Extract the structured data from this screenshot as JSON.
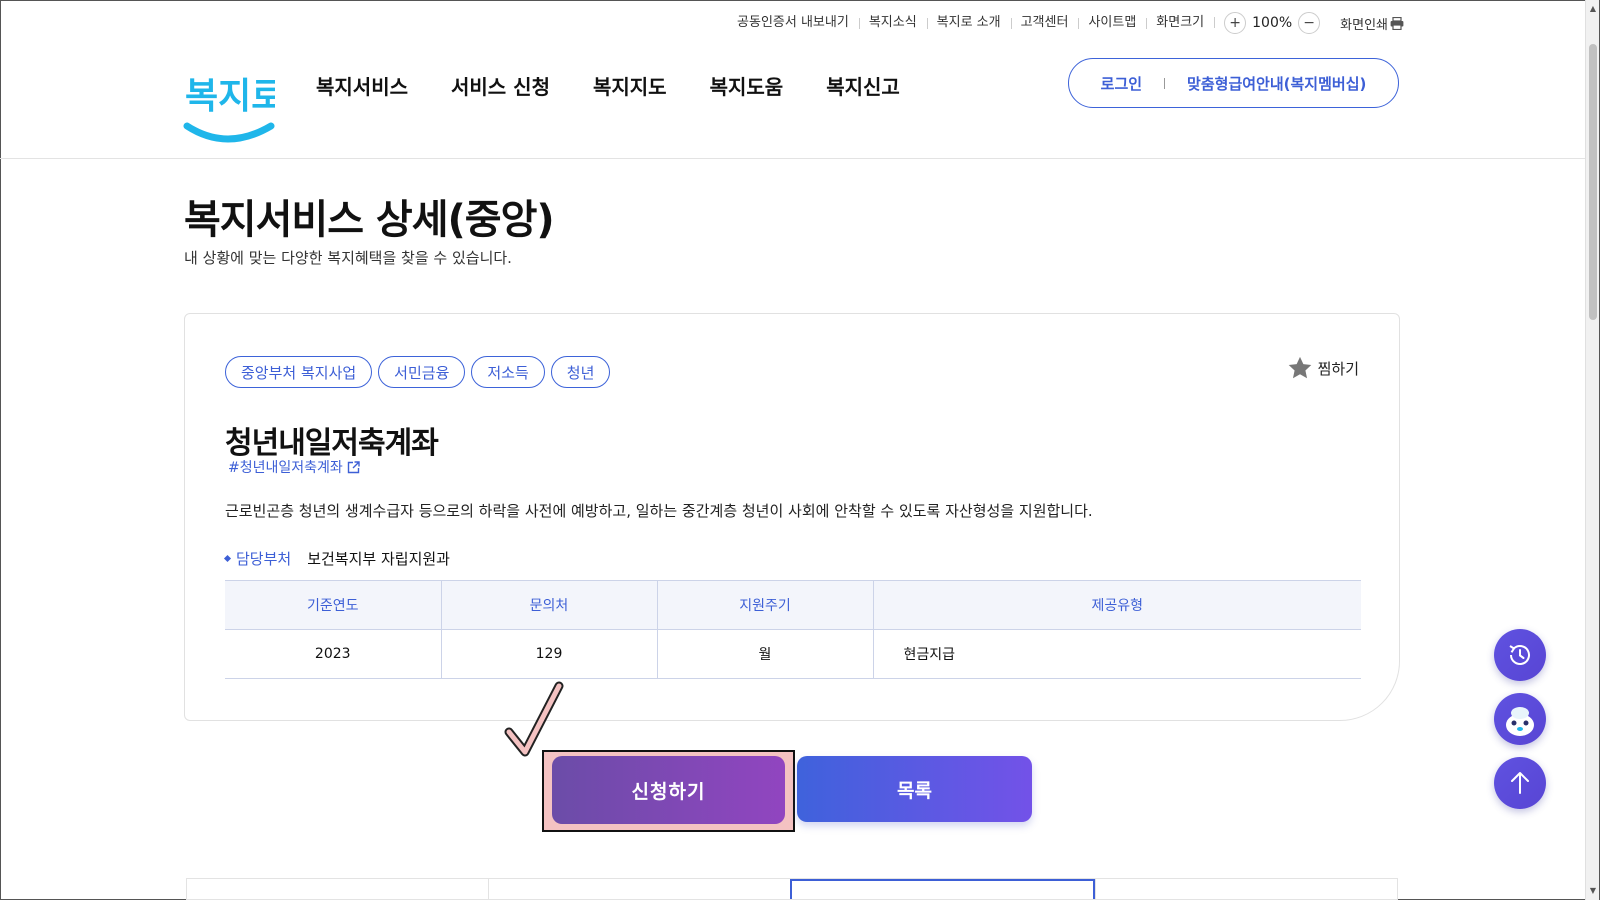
{
  "util": {
    "cert": "공동인증서 내보내기",
    "news": "복지소식",
    "about": "복지로 소개",
    "cs": "고객센터",
    "sitemap": "사이트맵",
    "screen_size": "화면크기",
    "zoom_in": "+",
    "zoom": "100%",
    "zoom_out": "−",
    "print": "화면인쇄"
  },
  "header": {
    "logo_text": "복지로",
    "nav": [
      "복지서비스",
      "서비스 신청",
      "복지지도",
      "복지도움",
      "복지신고"
    ],
    "login": "로그인",
    "membership": "맞춤형급여안내(복지멤버십)"
  },
  "page": {
    "title": "복지서비스 상세(중앙)",
    "subtitle": "내 상황에 맞는 다양한 복지혜택을 찾을 수 있습니다."
  },
  "service": {
    "tags": [
      "중앙부처 복지사업",
      "서민금융",
      "저소득",
      "청년"
    ],
    "favorite": "찜하기",
    "name": "청년내일저축계좌",
    "hashtag": "#청년내일저축계좌",
    "description": "근로빈곤층 청년의 생계수급자 등으로의 하락을 사전에 예방하고, 일하는 중간계층 청년이 사회에 안착할 수 있도록 자산형성을 지원합니다.",
    "dept_label": "담당부처",
    "dept_value": "보건복지부 자립지원과",
    "table": {
      "headers": [
        "기준연도",
        "문의처",
        "지원주기",
        "제공유형"
      ],
      "row": [
        "2023",
        "129",
        "월",
        "현금지급"
      ]
    }
  },
  "actions": {
    "apply": "신청하기",
    "list": "목록"
  },
  "colors": {
    "accent": "#3d5fd6",
    "apply_gradient": [
      "#6b4ca8",
      "#9145c0"
    ],
    "list_gradient": [
      "#3f62dc",
      "#7352e8"
    ],
    "logo_blue": "#1fb6ea"
  },
  "icons": {
    "favorite": "star-icon",
    "hashtag_link": "external-link-icon",
    "print": "printer-icon",
    "history": "history-icon",
    "chatbot": "chatbot-mascot-icon",
    "top": "arrow-up-icon"
  }
}
